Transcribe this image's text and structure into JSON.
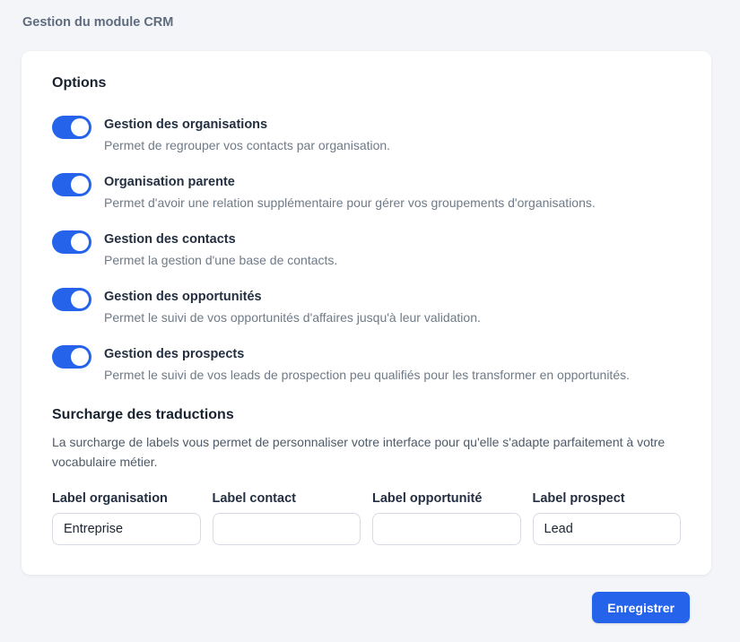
{
  "page": {
    "title": "Gestion du module CRM"
  },
  "colors": {
    "accent": "#2563eb",
    "page_background": "#f3f5f9",
    "card_background": "#ffffff",
    "heading_text": "#18222f",
    "muted_text": "#6f7a87"
  },
  "options_section": {
    "heading": "Options",
    "toggles": [
      {
        "label": "Gestion des organisations",
        "description": "Permet de regrouper vos contacts par organisation.",
        "state": "on"
      },
      {
        "label": "Organisation parente",
        "description": "Permet d'avoir une relation supplémentaire pour gérer vos groupements d'organisations.",
        "state": "on"
      },
      {
        "label": "Gestion des contacts",
        "description": "Permet la gestion d'une base de contacts.",
        "state": "on"
      },
      {
        "label": "Gestion des opportunités",
        "description": "Permet le suivi de vos opportunités d'affaires jusqu'à leur validation.",
        "state": "on"
      },
      {
        "label": "Gestion des prospects",
        "description": "Permet le suivi de vos leads de prospection peu qualifiés pour les transformer en opportunités.",
        "state": "on"
      }
    ]
  },
  "translations_section": {
    "heading": "Surcharge des traductions",
    "description": "La surcharge de labels vous permet de personnaliser votre interface pour qu'elle s'adapte parfaitement à votre vocabulaire métier.",
    "fields": [
      {
        "label": "Label organisation",
        "value": "Entreprise",
        "placeholder": ""
      },
      {
        "label": "Label contact",
        "value": "",
        "placeholder": ""
      },
      {
        "label": "Label opportunité",
        "value": "",
        "placeholder": ""
      },
      {
        "label": "Label prospect",
        "value": "Lead",
        "placeholder": ""
      }
    ]
  },
  "footer": {
    "save_label": "Enregistrer"
  }
}
